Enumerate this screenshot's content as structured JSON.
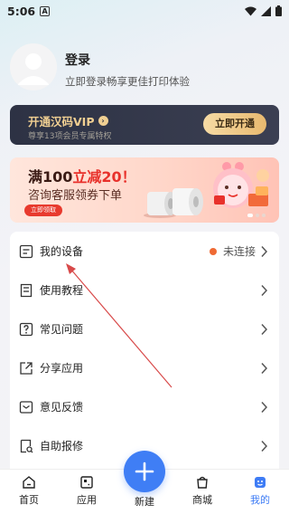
{
  "status_bar": {
    "time": "5:06",
    "badge": "A"
  },
  "profile": {
    "title": "登录",
    "subtitle": "立即登录畅享更佳打印体验"
  },
  "vip": {
    "title": "开通汉码VIP",
    "subtitle": "尊享13项会员专属特权",
    "button": "立即开通"
  },
  "banner": {
    "line1_prefix": "满100",
    "line1_highlight": "立减20！",
    "line2": "咨询客服领券下单",
    "button": "立即领取"
  },
  "menu": {
    "items": [
      {
        "label": "我的设备",
        "status": "未连接"
      },
      {
        "label": "使用教程"
      },
      {
        "label": "常见问题"
      },
      {
        "label": "分享应用"
      },
      {
        "label": "意见反馈"
      },
      {
        "label": "自助报修"
      }
    ]
  },
  "tabs": [
    {
      "label": "首页",
      "icon": "home-icon"
    },
    {
      "label": "应用",
      "icon": "apps-icon"
    },
    {
      "label": "新建",
      "icon": "plus-icon"
    },
    {
      "label": "商城",
      "icon": "shopping-bag-icon"
    },
    {
      "label": "我的",
      "icon": "profile-icon",
      "active": true
    }
  ],
  "colors": {
    "accent": "#3e7cf5",
    "vip_gold": "#f0cf92",
    "promo_red": "#e8312b",
    "status_dot": "#ef6a34"
  }
}
